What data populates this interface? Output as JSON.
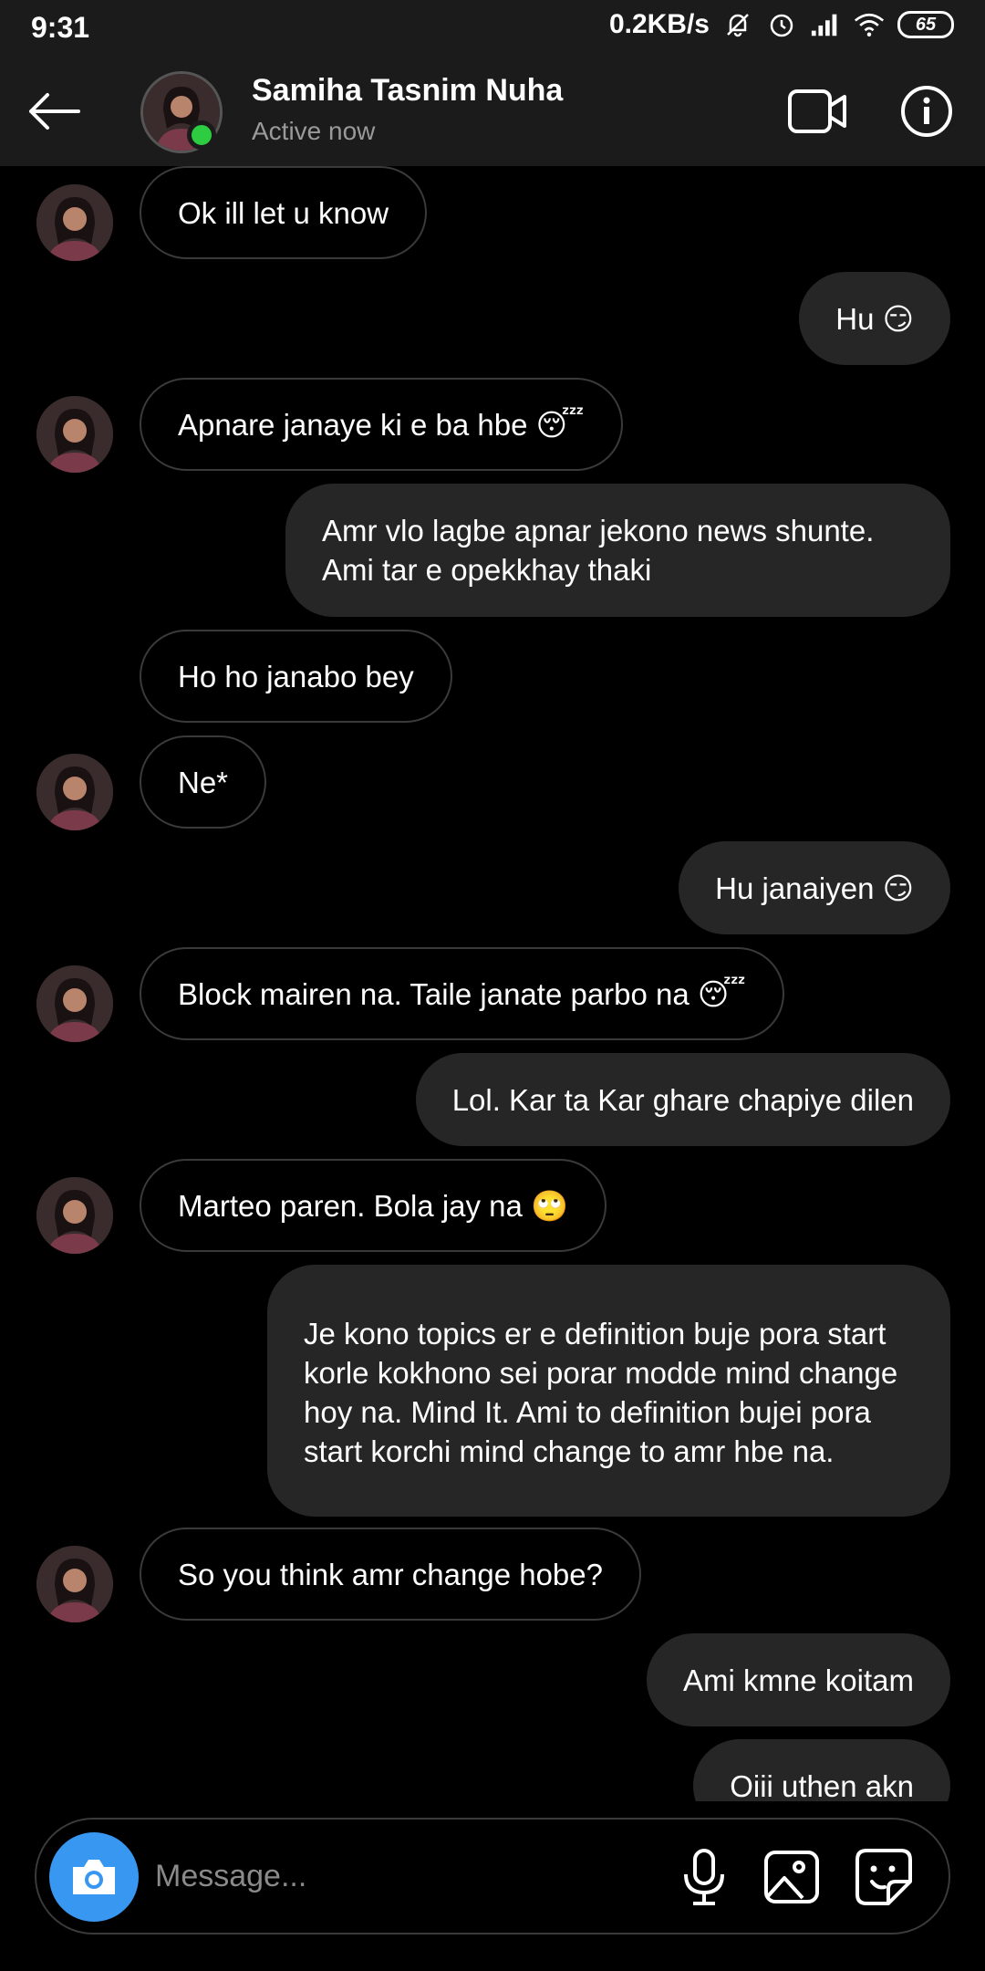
{
  "status_bar": {
    "time": "9:31",
    "net_speed": "0.2KB/s",
    "battery": "65"
  },
  "header": {
    "contact_name": "Samiha Tasnim Nuha",
    "contact_status": "Active now"
  },
  "messages": [
    {
      "side": "in",
      "text": "Ok ill let u know"
    },
    {
      "side": "out",
      "text": "Hu 😏"
    },
    {
      "side": "in",
      "text": "Apnare janaye ki e ba hbe 😴"
    },
    {
      "side": "out",
      "text": "Amr vlo lagbe apnar jekono news shunte. Ami tar e opekkhay thaki"
    },
    {
      "side": "in",
      "text": "Ho ho janabo bey"
    },
    {
      "side": "in",
      "text": "Ne*"
    },
    {
      "side": "out",
      "text": "Hu janaiyen 😏"
    },
    {
      "side": "in",
      "text": "Block mairen na. Taile janate parbo na 😴"
    },
    {
      "side": "out",
      "text": "Lol. Kar ta Kar ghare chapiye dilen"
    },
    {
      "side": "in",
      "text": "Marteo paren. Bola jay na 🙄"
    },
    {
      "side": "out",
      "text": "Je kono topics er e definition buje pora start korle kokhono sei porar modde mind change hoy na. Mind It. Ami to definition bujei pora start korchi mind change to amr hbe na."
    },
    {
      "side": "in",
      "text": "So you think amr change hobe?"
    },
    {
      "side": "out",
      "text": "Ami kmne koitam"
    },
    {
      "side": "out",
      "text": "Oiii uthen akn"
    }
  ],
  "composer": {
    "placeholder": "Message..."
  },
  "icons": {
    "back": "arrow-left-icon",
    "video": "video-camera-icon",
    "info": "info-icon",
    "camera": "camera-icon",
    "mic": "microphone-icon",
    "gallery": "image-icon",
    "sticker": "sticker-icon"
  },
  "colors": {
    "camera_button": "#3897f0",
    "online_dot": "#2ecc40",
    "outgoing_bubble": "#262626"
  }
}
